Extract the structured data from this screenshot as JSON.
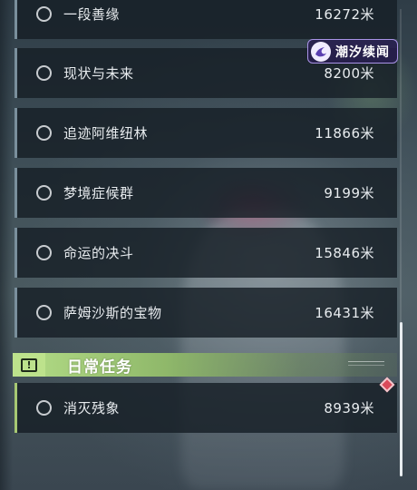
{
  "quests": [
    {
      "name": "一段善缘",
      "distance": "16272米"
    },
    {
      "name": "现状与未来",
      "distance": "8200米"
    },
    {
      "name": "追迹阿维纽林",
      "distance": "11866米"
    },
    {
      "name": "梦境症候群",
      "distance": "9199米"
    },
    {
      "name": "命运的决斗",
      "distance": "15846米"
    },
    {
      "name": "萨姆沙斯的宝物",
      "distance": "16431米"
    }
  ],
  "daily_section": {
    "title": "日常任务",
    "badge_icon": "exclamation-icon"
  },
  "daily_quests": [
    {
      "name": "消灭残象",
      "distance": "8939米"
    }
  ],
  "watermark": {
    "text": "潮汐续闻",
    "logo_icon": "wave-logo-icon"
  },
  "colors": {
    "row_background": "#161e26",
    "row_accent": "#7a8f9c",
    "daily_accent": "#a7c873",
    "header_green": "#b4dd87",
    "marker_red": "#d94a5a",
    "watermark_purple": "#a993e6"
  }
}
